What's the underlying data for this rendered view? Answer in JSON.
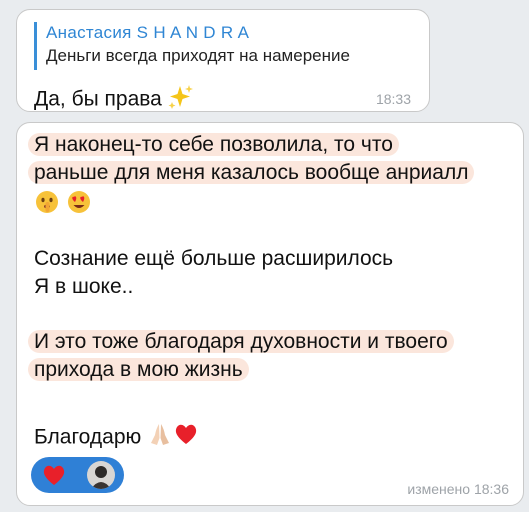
{
  "messages": [
    {
      "reply": {
        "author": "Анастасия S H A N D R A",
        "text": "Деньги всегда приходят на намерение"
      },
      "text": "Да, бы права",
      "time": "18:33"
    },
    {
      "lines": [
        "Я наконец-то себе позволила, то что",
        "раньше для меня казалось вообще анриалл",
        "Сознание ещё больше расширилось",
        "Я в шоке..",
        "И это тоже благодаря духовности и твоего",
        "прихода в мою жизнь",
        "Благодарю"
      ],
      "reactions": [
        "heart",
        "avatar"
      ],
      "time": "изменено 18:36"
    }
  ],
  "colors": {
    "accent": "#2f86d4",
    "highlight": "#fbe6dc",
    "reaction_bg": "#2f80d6",
    "heart": "#e8202a"
  },
  "icons": [
    "sparkles-icon",
    "shushing-face-icon",
    "heart-eyes-icon",
    "pray-icon",
    "heart-icon",
    "avatar"
  ]
}
